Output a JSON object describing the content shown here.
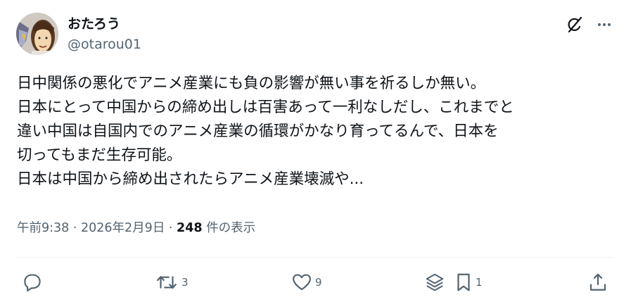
{
  "author": {
    "display_name": "おたろう",
    "handle": "@otarou01"
  },
  "post": {
    "lines": [
      "日中関係の悪化でアニメ産業にも負の影響が無い事を祈るしか無い。",
      "日本にとって中国からの締め出しは百害あって一利なしだし、これまでと",
      "違い中国は自国内でのアニメ産業の循環がかなり育ってるんで、日本を",
      "切ってもまだ生存可能。",
      "日本は中国から締め出されたらアニメ産業壊滅や..."
    ]
  },
  "meta": {
    "time": "午前9:38",
    "sep1": " · ",
    "date": "2026年2月9日",
    "sep2": " · ",
    "views_count": "248",
    "views_label": " 件の表示"
  },
  "actions": {
    "reply_count": "",
    "repost_count": "3",
    "like_count": "9",
    "bookmark_count": "1"
  },
  "colors": {
    "text": "#0f1419",
    "secondary": "#536471",
    "divider": "#eff3f4"
  }
}
